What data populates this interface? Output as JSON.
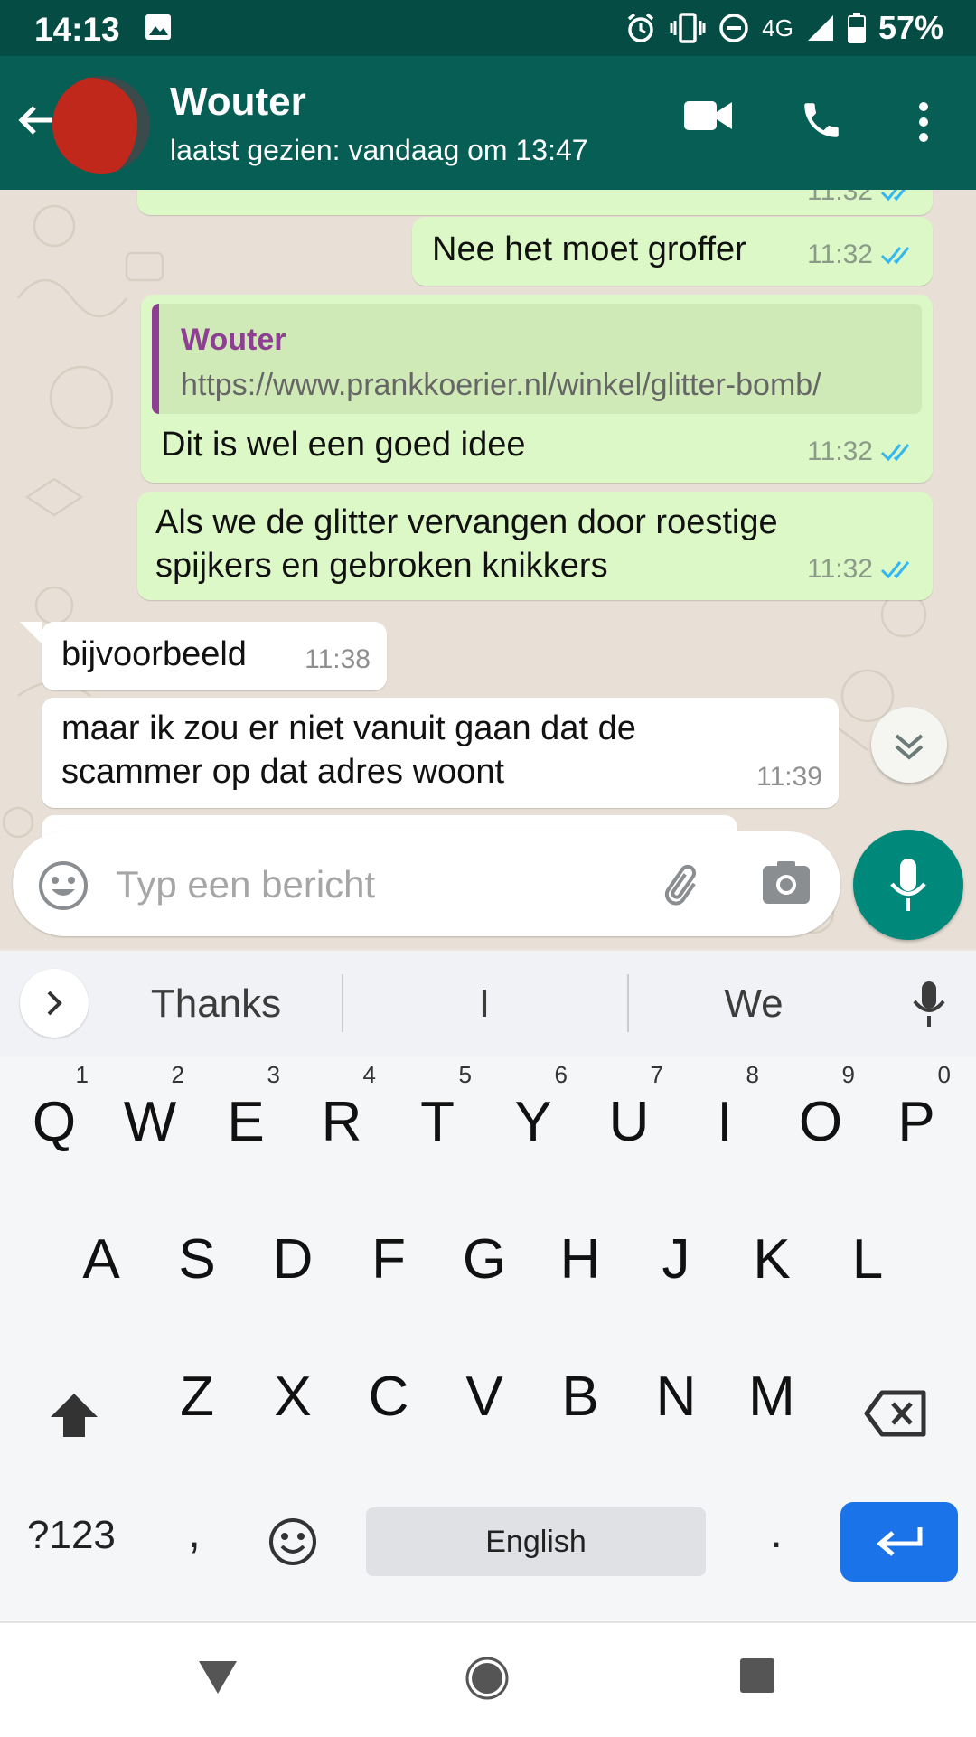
{
  "status_bar": {
    "time": "14:13",
    "network": "4G",
    "battery": "57%"
  },
  "header": {
    "contact_name": "Wouter",
    "last_seen": "laatst gezien: vandaag om 13:47"
  },
  "messages": [
    {
      "type": "outgoing",
      "text": "Nee het moet groffer",
      "time": "11:32",
      "status": "read"
    },
    {
      "type": "outgoing",
      "quote_author": "Wouter",
      "quote_text": "https://www.prankkoerier.nl/winkel/glitter-bomb/",
      "text": "Dit is wel een goed idee",
      "time": "11:32",
      "status": "read"
    },
    {
      "type": "outgoing",
      "line1": "Als we de glitter vervangen door roestige",
      "line2": "spijkers en gebroken knikkers",
      "time": "11:32",
      "status": "read"
    },
    {
      "type": "incoming",
      "text": "bijvoorbeeld",
      "time": "11:38"
    },
    {
      "type": "incoming",
      "line1": "maar ik zou er niet vanuit gaan dat de",
      "line2": "scammer op dat adres woont",
      "time": "11:39"
    }
  ],
  "partial_top_time": "11:32",
  "composer": {
    "placeholder": "Typ een bericht"
  },
  "suggestions": [
    "Thanks",
    "I",
    "We"
  ],
  "keyboard": {
    "row1": [
      {
        "key": "Q",
        "hint": "1"
      },
      {
        "key": "W",
        "hint": "2"
      },
      {
        "key": "E",
        "hint": "3"
      },
      {
        "key": "R",
        "hint": "4"
      },
      {
        "key": "T",
        "hint": "5"
      },
      {
        "key": "Y",
        "hint": "6"
      },
      {
        "key": "U",
        "hint": "7"
      },
      {
        "key": "I",
        "hint": "8"
      },
      {
        "key": "O",
        "hint": "9"
      },
      {
        "key": "P",
        "hint": "0"
      }
    ],
    "row2": [
      "A",
      "S",
      "D",
      "F",
      "G",
      "H",
      "J",
      "K",
      "L"
    ],
    "row3": [
      "Z",
      "X",
      "C",
      "V",
      "B",
      "N",
      "M"
    ],
    "symbols": "?123",
    "comma": ",",
    "space": "English",
    "period": "."
  },
  "colors": {
    "header": "#075e54",
    "status_bar": "#054d44",
    "outgoing_bubble": "#dcf8c6",
    "read_ticks": "#34b7f1",
    "accent": "#00897b",
    "enter_key": "#1a73e8"
  }
}
